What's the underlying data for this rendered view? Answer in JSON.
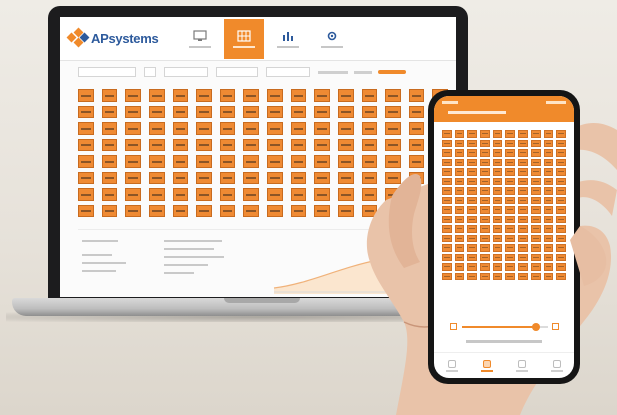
{
  "app": {
    "brand": "APsystems",
    "accent_color": "#f08a2b",
    "brand_blue": "#2d5a9c"
  },
  "laptop_nav": {
    "items": [
      {
        "icon": "monitor-icon",
        "active": false
      },
      {
        "icon": "module-grid-icon",
        "active": true
      },
      {
        "icon": "bar-chart-icon",
        "active": false
      },
      {
        "icon": "gear-icon",
        "active": false
      }
    ]
  },
  "module_grid": {
    "rows": 8,
    "columns": 16
  },
  "phone": {
    "module_grid": {
      "rows": 16,
      "columns": 10
    },
    "slider_value": 0.86,
    "tabs": [
      {
        "icon": "home-icon",
        "active": false
      },
      {
        "icon": "module-grid-icon",
        "active": true
      },
      {
        "icon": "bar-chart-icon",
        "active": false
      },
      {
        "icon": "settings-icon",
        "active": false
      }
    ]
  }
}
